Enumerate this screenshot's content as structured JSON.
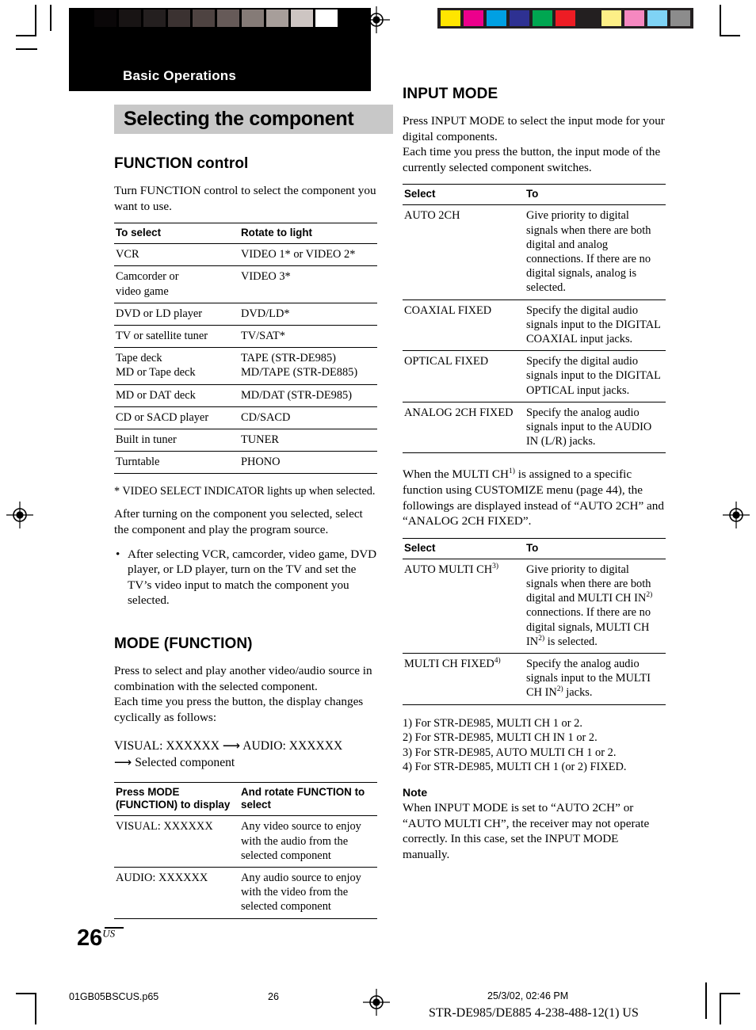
{
  "print_marks": {
    "gray_scale_swatches": [
      "#000000",
      "#0a0708",
      "#181414",
      "#241f1f",
      "#3b3231",
      "#4e4341",
      "#665a58",
      "#857b77",
      "#a79e9a",
      "#cdc5c2",
      "#ffffff"
    ],
    "color_swatches": [
      "#ffe500",
      "#ec008c",
      "#00a0e3",
      "#2e3192",
      "#00a651",
      "#ed1c24",
      "#231f20",
      "#fdef87",
      "#f588c0",
      "#7fd3f5",
      "#8c8c8c"
    ]
  },
  "header": {
    "section_tag": "Basic Operations",
    "chapter_title": "Selecting the component"
  },
  "left_column": {
    "function_control": {
      "heading": "FUNCTION control",
      "intro": "Turn FUNCTION control to select the component you want to use.",
      "table": {
        "headers": [
          "To select",
          "Rotate to light"
        ],
        "rows": [
          {
            "select": "VCR",
            "to": "VIDEO 1* or VIDEO 2*"
          },
          {
            "select": "Camcorder or\nvideo game",
            "to": "VIDEO 3*"
          },
          {
            "select": "DVD or LD player",
            "to": "DVD/LD*"
          },
          {
            "select": "TV or satellite tuner",
            "to": "TV/SAT*"
          },
          {
            "select": "Tape deck",
            "to": "TAPE (STR-DE985)"
          },
          {
            "select": "MD or Tape deck",
            "to": "MD/TAPE (STR-DE885)"
          },
          {
            "select": "MD or DAT deck",
            "to": "MD/DAT (STR-DE985)"
          },
          {
            "select": "CD or SACD player",
            "to": "CD/SACD"
          },
          {
            "select": "Built in tuner",
            "to": "TUNER"
          },
          {
            "select": "Turntable",
            "to": "PHONO"
          }
        ]
      },
      "footnote": "* VIDEO SELECT INDICATOR lights up when selected.",
      "after_text": "After turning on the component you selected, select the component and play the program source.",
      "bullets": [
        "After selecting VCR, camcorder, video game, DVD player, or LD player, turn on the TV and set the TV’s video input to match the component you selected."
      ]
    },
    "mode_function": {
      "heading": "MODE (FUNCTION)",
      "para1": "Press to select and play another video/audio source in combination with the selected component.",
      "para2": "Each time you press the button, the display changes cyclically as follows:",
      "flow_line1": "VISUAL: XXXXXX ⟶ AUDIO: XXXXXX",
      "flow_line2": "⟶ Selected component",
      "table": {
        "headers": [
          "Press MODE (FUNCTION) to display",
          "And rotate FUNCTION to select"
        ],
        "rows": [
          {
            "select": "VISUAL: XXXXXX",
            "to": "Any video source to enjoy with the audio from the selected component"
          },
          {
            "select": "AUDIO: XXXXXX",
            "to": "Any audio source to enjoy with the video from the selected component"
          }
        ]
      }
    }
  },
  "right_column": {
    "input_mode": {
      "heading": "INPUT MODE",
      "para1": "Press INPUT MODE to select the input mode for your digital components.",
      "para2": "Each time you press the button, the input mode of the currently selected component switches.",
      "table1": {
        "headers": [
          "Select",
          "To"
        ],
        "rows": [
          {
            "select": "AUTO 2CH",
            "to": "Give priority to digital signals when there are both digital and analog connections. If there are no digital signals, analog is selected."
          },
          {
            "select": "COAXIAL FIXED",
            "to": "Specify the digital audio signals input to the DIGITAL COAXIAL input jacks."
          },
          {
            "select": "OPTICAL FIXED",
            "to": "Specify the digital audio signals input to the DIGITAL OPTICAL input jacks."
          },
          {
            "select": "ANALOG 2CH FIXED",
            "to": "Specify the analog audio signals input to the AUDIO IN (L/R) jacks."
          }
        ]
      },
      "multi_ch_para": "When the MULTI CH1) is assigned to a specific function using CUSTOMIZE menu (page 44), the followings are displayed instead of “AUTO 2CH” and “ANALOG 2CH FIXED”.",
      "table2": {
        "headers": [
          "Select",
          "To"
        ],
        "rows": [
          {
            "select": "AUTO MULTI CH3)",
            "to": "Give priority to digital signals when there are both digital and MULTI CH IN2) connections. If there are no digital signals, MULTI CH IN2) is selected."
          },
          {
            "select": "MULTI CH FIXED4)",
            "to": "Specify the analog audio signals input to the MULTI CH IN2) jacks."
          }
        ]
      },
      "footnotes": [
        "1) For STR-DE985, MULTI CH 1 or 2.",
        "2) For STR-DE985, MULTI CH IN 1 or 2.",
        "3) For STR-DE985, AUTO MULTI CH 1 or 2.",
        "4) For STR-DE985, MULTI CH 1 (or 2) FIXED."
      ],
      "note_heading": "Note",
      "note_body": "When INPUT MODE is set to “AUTO 2CH” or “AUTO MULTI CH”, the receiver may not operate correctly. In this case, set the INPUT MODE manually."
    }
  },
  "page_footer": {
    "page_number": "26",
    "page_number_sup": "US",
    "file_name": "01GB05BSCUS.p65",
    "footer_page": "26",
    "date_time": "25/3/02, 02:46 PM",
    "model_code": "STR-DE985/DE885    4-238-488-12(1) US"
  }
}
